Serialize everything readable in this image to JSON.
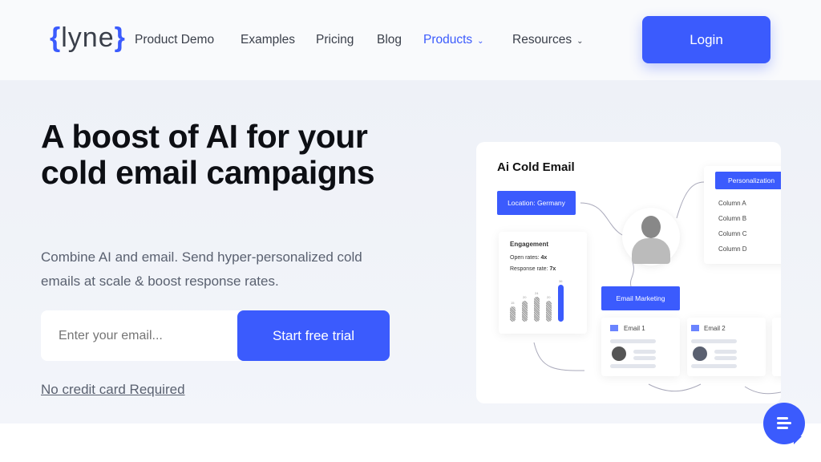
{
  "nav": {
    "logo": "{lyne}",
    "items": [
      "Product Demo",
      "Examples",
      "Pricing",
      "Blog",
      "Products",
      "Resources"
    ],
    "login": "Login"
  },
  "hero": {
    "title": "A boost of AI for your cold email campaigns",
    "subtitle": "Combine AI and email. Send hyper-personalized cold emails at scale & boost response rates.",
    "email_placeholder": "Enter your email...",
    "cta": "Start free trial",
    "note": "No credit card Required"
  },
  "illustration": {
    "title": "Ai Cold Email",
    "location": "Location:  Germany",
    "personalization": "Personalization",
    "columns": [
      "Column A",
      "Column B",
      "Column C",
      "Column D"
    ],
    "engagement": {
      "title": "Engagement",
      "open_label": "Open rates:",
      "open_value": "4x",
      "response_label": "Response rate:",
      "response_value": "7x",
      "bars": [
        15,
        20,
        24,
        20,
        36
      ]
    },
    "email_marketing": "Email Marketing",
    "email1": "Email 1",
    "email2": "Email 2"
  },
  "colors": {
    "accent": "#3b5bfd"
  },
  "icons": {
    "chat": "chat-bubble-icon",
    "email": "envelope-icon",
    "chevron": "chevron-down-icon"
  }
}
